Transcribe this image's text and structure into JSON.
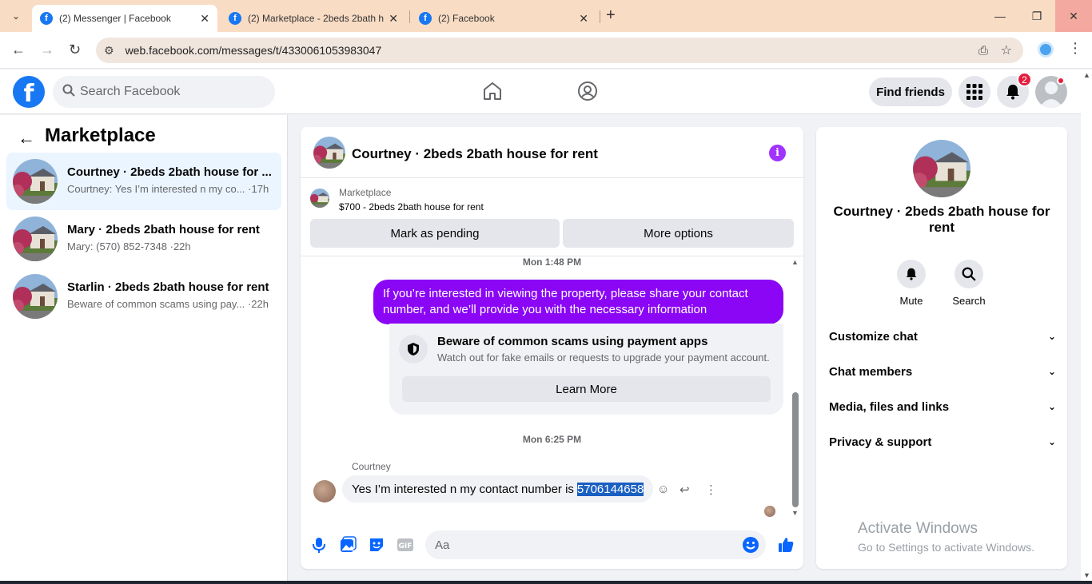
{
  "browser": {
    "tabs": [
      {
        "title": "(2) Messenger | Facebook",
        "active": true
      },
      {
        "title": "(2) Marketplace - 2beds 2bath h",
        "active": false
      },
      {
        "title": "(2) Facebook",
        "active": false
      }
    ],
    "url": "web.facebook.com/messages/t/4330061053983047"
  },
  "header": {
    "search_placeholder": "Search Facebook",
    "find_friends": "Find friends",
    "notification_count": "2"
  },
  "sidebar": {
    "title": "Marketplace",
    "conversations": [
      {
        "name": "Courtney · 2beds 2bath house for ...",
        "preview": "Courtney: Yes I’m interested n my co... ·17h",
        "active": true
      },
      {
        "name": "Mary · 2beds 2bath house for rent",
        "preview": "Mary: (570) 852-7348 ·22h",
        "active": false
      },
      {
        "name": "Starlin · 2beds 2bath house for rent",
        "preview": "Beware of common scams using pay... ·22h",
        "active": false
      }
    ]
  },
  "chat": {
    "title": "Courtney · 2beds 2bath house for rent",
    "marketplace_label": "Marketplace",
    "listing": "$700 - 2beds 2bath house for rent",
    "mark_pending": "Mark as pending",
    "more_options": "More options",
    "timestamp1": "Mon 1:48 PM",
    "outgoing_message": "If you’re interested in viewing the property, please share your contact number, and we’ll provide you with the necessary information",
    "scam_title": "Beware of common scams using payment apps",
    "scam_text": "Watch out for fake emails or requests to upgrade your payment account.",
    "learn_more": "Learn More",
    "timestamp2": "Mon 6:25 PM",
    "sender_name": "Courtney",
    "incoming_text": "Yes I’m interested n my contact number is",
    "incoming_number": "5706144658",
    "composer_placeholder": "Aa"
  },
  "details": {
    "name": "Courtney · 2beds 2bath house for rent",
    "mute": "Mute",
    "search": "Search",
    "sections": [
      "Customize chat",
      "Chat members",
      "Media, files and links",
      "Privacy & support"
    ]
  },
  "watermark": {
    "line1": "Activate Windows",
    "line2": "Go to Settings to activate Windows."
  },
  "colors": {
    "facebook_blue": "#1877f2",
    "outgoing_bubble": "#8a06f5",
    "info_icon": "#a033ff"
  }
}
